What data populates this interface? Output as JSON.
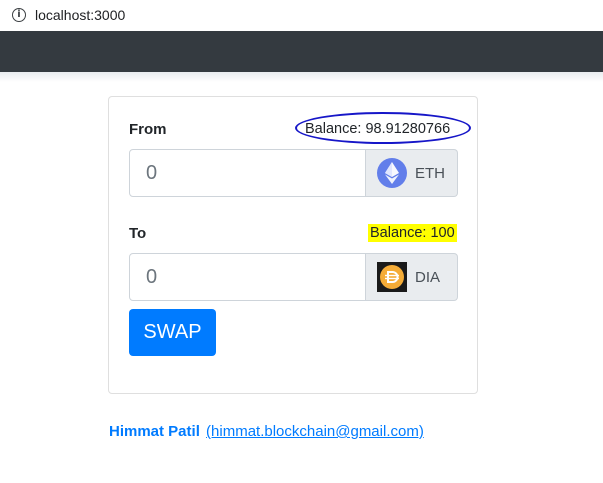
{
  "browser": {
    "url": "localhost:3000",
    "info_icon": "info-icon"
  },
  "swap": {
    "from": {
      "label": "From",
      "balance": "Balance: 98.91280766",
      "placeholder": "0",
      "token": "ETH",
      "token_icon": "ethereum-icon",
      "annotation": "blue-circle"
    },
    "to": {
      "label": "To",
      "balance": "Balance: 100",
      "placeholder": "0",
      "token": "DIA",
      "token_icon": "dai-icon",
      "annotation": "yellow-highlight"
    },
    "button_label": "SWAP"
  },
  "footer": {
    "author": "Himmat Patil",
    "email": "(himmat.blockchain@gmail.com)"
  },
  "colors": {
    "primary": "#007bff",
    "navbar": "#343a40",
    "annotation_circle": "#1616c8",
    "highlight": "#ffff00",
    "eth": "#627eea",
    "dai": "#f5ac37"
  }
}
